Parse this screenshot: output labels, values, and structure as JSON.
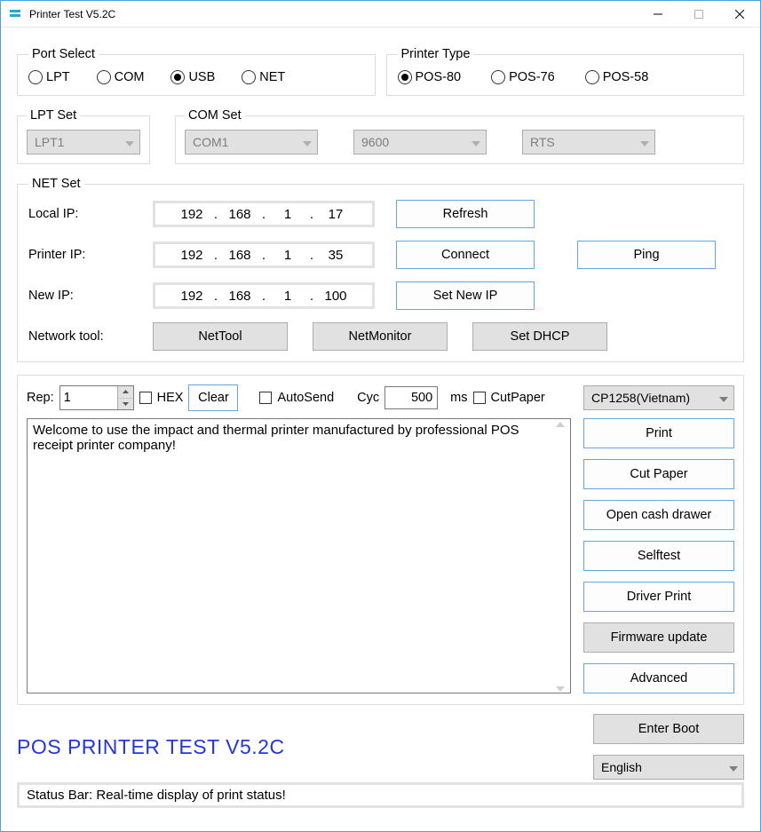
{
  "window": {
    "title": "Printer Test V5.2C"
  },
  "portSelect": {
    "legend": "Port Select",
    "options": [
      {
        "label": "LPT",
        "checked": false
      },
      {
        "label": "COM",
        "checked": false
      },
      {
        "label": "USB",
        "checked": true
      },
      {
        "label": "NET",
        "checked": false
      }
    ]
  },
  "printerType": {
    "legend": "Printer Type",
    "options": [
      {
        "label": "POS-80",
        "checked": true
      },
      {
        "label": "POS-76",
        "checked": false
      },
      {
        "label": "POS-58",
        "checked": false
      }
    ]
  },
  "lptSet": {
    "legend": "LPT Set",
    "value": "LPT1"
  },
  "comSet": {
    "legend": "COM Set",
    "port": "COM1",
    "baud": "9600",
    "flow": "RTS"
  },
  "netSet": {
    "legend": "NET Set",
    "localIp": {
      "label": "Local IP:",
      "o1": "192",
      "o2": "168",
      "o3": "1",
      "o4": "17"
    },
    "printerIp": {
      "label": "Printer IP:",
      "o1": "192",
      "o2": "168",
      "o3": "1",
      "o4": "35"
    },
    "newIp": {
      "label": "New IP:",
      "o1": "192",
      "o2": "168",
      "o3": "1",
      "o4": "100"
    },
    "networkToolLabel": "Network tool:",
    "buttons": {
      "refresh": "Refresh",
      "connect": "Connect",
      "ping": "Ping",
      "setNewIp": "Set New IP",
      "nettool": "NetTool",
      "netmonitor": "NetMonitor",
      "setdhcp": "Set DHCP"
    }
  },
  "mid": {
    "repLabel": "Rep:",
    "repValue": "1",
    "hexLabel": "HEX",
    "clear": "Clear",
    "autosend": "AutoSend",
    "cycLabel": "Cyc",
    "cycValue": "500",
    "msLabel": "ms",
    "cutpaper": "CutPaper",
    "encoding": "CP1258(Vietnam)"
  },
  "textarea": "Welcome to use the impact and thermal printer manufactured by professional POS receipt printer company!",
  "side": {
    "print": "Print",
    "cutPaper": "Cut Paper",
    "openDrawer": "Open cash drawer",
    "selftest": "Selftest",
    "driverPrint": "Driver Print",
    "firmware": "Firmware update",
    "advanced": "Advanced",
    "enterBoot": "Enter Boot"
  },
  "appTitle": "POS PRINTER TEST V5.2C",
  "language": "English",
  "statusBar": "Status Bar: Real-time display of print status!"
}
